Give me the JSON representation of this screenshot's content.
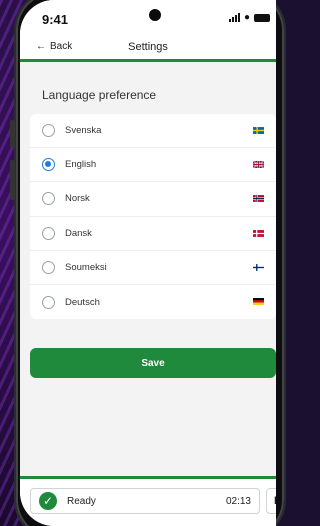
{
  "status_bar": {
    "time": "9:41"
  },
  "nav": {
    "back_label": "Back",
    "title": "Settings"
  },
  "section": {
    "title": "Language preference"
  },
  "languages": [
    {
      "label": "Svenska",
      "selected": false,
      "flag": "se"
    },
    {
      "label": "English",
      "selected": true,
      "flag": "gb"
    },
    {
      "label": "Norsk",
      "selected": false,
      "flag": "no"
    },
    {
      "label": "Dansk",
      "selected": false,
      "flag": "dk"
    },
    {
      "label": "Soumeksi",
      "selected": false,
      "flag": "fi"
    },
    {
      "label": "Deutsch",
      "selected": false,
      "flag": "de"
    }
  ],
  "actions": {
    "save_label": "Save"
  },
  "player": {
    "status": "Ready",
    "time": "02:13"
  },
  "colors": {
    "accent": "#1f8a3c",
    "radio_selected": "#1f7ae0"
  }
}
